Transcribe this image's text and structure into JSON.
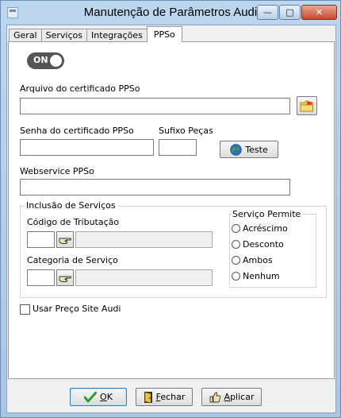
{
  "window": {
    "title": "Manutenção de Parâmetros Audi",
    "min_glyph": "—",
    "max_glyph": "□",
    "close_glyph": "✕"
  },
  "tabs": [
    {
      "label": "Geral",
      "active": false
    },
    {
      "label": "Serviços",
      "active": false
    },
    {
      "label": "Integrações",
      "active": false
    },
    {
      "label": "PPSo",
      "active": true
    }
  ],
  "toggle": {
    "label": "ON",
    "state": true
  },
  "cert_file": {
    "label": "Arquivo do certificado PPSo",
    "value": "",
    "browse_icon": "folder-icon"
  },
  "cert_password": {
    "label": "Senha do certificado PPSo",
    "value": ""
  },
  "suffix": {
    "label": "Sufixo Peças",
    "value": ""
  },
  "test_button": {
    "label": "Teste",
    "icon": "globe-icon"
  },
  "webservice": {
    "label": "Webservice PPSo",
    "value": ""
  },
  "services_group": {
    "title": "Inclusão de Serviços",
    "tax_code": {
      "label": "Código de Tributação",
      "code": "",
      "description": ""
    },
    "category": {
      "label": "Categoria de Serviço",
      "code": "",
      "description": ""
    },
    "lookup_icon": "pointing-hand-icon"
  },
  "service_allows": {
    "title": "Serviço Permite",
    "options": [
      "Acréscimo",
      "Desconto",
      "Ambos",
      "Nenhum"
    ],
    "selected": null
  },
  "use_site_price": {
    "label": "Usar Preço Site Audi",
    "checked": false
  },
  "footer": {
    "ok": {
      "label": "OK",
      "accel": "O",
      "rest": "K",
      "icon": "checkmark-icon"
    },
    "close": {
      "label": "Fechar",
      "accel": "F",
      "rest": "echar",
      "icon": "door-exit-icon"
    },
    "apply": {
      "label": "Aplicar",
      "accel": "A",
      "rest": "plicar",
      "icon": "thumbs-up-icon"
    }
  },
  "colors": {
    "titlebar": "#bcd6ee",
    "close_button": "#c7482d",
    "ok_check": "#2e9b2e"
  }
}
